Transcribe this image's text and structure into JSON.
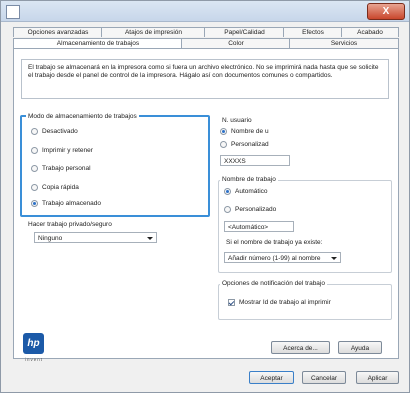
{
  "titlebar": {
    "close_label": "X"
  },
  "tabs": {
    "row_back": [
      "Opciones avanzadas",
      "Atajos de impresión",
      "Papel/Calidad",
      "Efectos",
      "Acabado"
    ],
    "row_front": [
      "Almacenamiento de trabajos",
      "Color",
      "Servicios"
    ]
  },
  "description": "El trabajo se almacenará en la impresora como si fuera un archivo electrónico. No se imprimirá nada hasta que se solicite el trabajo desde el panel de control de la impresora. Hágalo así con documentos comunes o compartidos.",
  "storage_mode": {
    "label": "Modo de almacenamiento de trabajos",
    "options": [
      "Desactivado",
      "Imprimir y retener",
      "Trabajo personal",
      "Copia rápida",
      "Trabajo almacenado"
    ],
    "selected_index": 4
  },
  "private": {
    "label": "Hacer trabajo privado/seguro",
    "value": "Ninguno"
  },
  "username": {
    "label": "N. usuario",
    "opt_user": "Nombre de u",
    "opt_custom": "Personalizad",
    "value": "XXXXS"
  },
  "jobname": {
    "label": "Nombre de trabajo",
    "opt_auto": "Automático",
    "opt_custom": "Personalizado",
    "value": "<Automático>",
    "exists_label": "Si el nombre de trabajo ya existe:",
    "exists_value": "Añadir número (1-99) al nombre"
  },
  "notify": {
    "label": "Opciones de notificación del trabajo",
    "checkbox": "Mostrar Id de trabajo al imprimir",
    "checked": true
  },
  "logo": {
    "mark": "hp",
    "sub": "invent"
  },
  "buttons": {
    "about": "Acerca de...",
    "help": "Ayuda",
    "ok": "Aceptar",
    "cancel": "Cancelar",
    "apply": "Aplicar"
  }
}
